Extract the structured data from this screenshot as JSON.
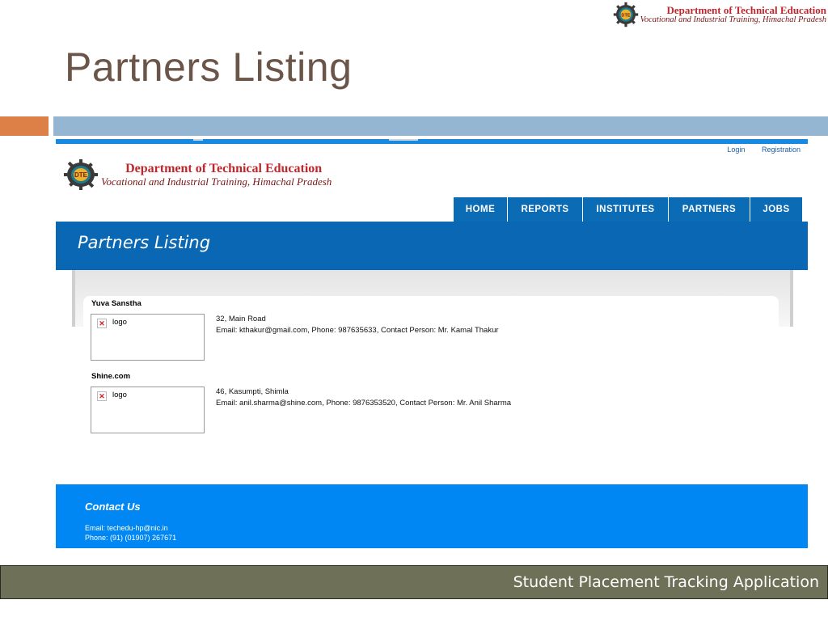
{
  "slide": {
    "title": "Partners Listing",
    "footer": "Student Placement Tracking Application",
    "logo": {
      "line1": "Department of Technical Education",
      "line2": "Vocational and Industrial Training, Himachal Pradesh"
    }
  },
  "site": {
    "top_links": [
      "Login",
      "Registration"
    ],
    "logo": {
      "line1": "Department of Technical Education",
      "line2": "Vocational and Industrial Training, Himachal Pradesh"
    },
    "nav": [
      {
        "label": "HOME"
      },
      {
        "label": "REPORTS"
      },
      {
        "label": "INSTITUTES"
      },
      {
        "label": "PARTNERS"
      },
      {
        "label": "JOBS"
      }
    ],
    "hero_title": "Partners Listing",
    "partners": [
      {
        "name": "Yuva Sanstha",
        "logo_alt": "logo",
        "address": "32, Main Road",
        "details": "Email: kthakur@gmail.com, Phone: 987635633, Contact Person: Mr. Kamal Thakur"
      },
      {
        "name": "Shine.com",
        "logo_alt": "logo",
        "address": "46, Kasumpti, Shimla",
        "details": "Email: anil.sharma@shine.com, Phone: 9876353520, Contact Person: Mr. Anil Sharma"
      }
    ],
    "contact": {
      "title": "Contact Us",
      "email": "Email: techedu-hp@nic.in",
      "phone": "Phone: (91) (01907) 267671"
    }
  },
  "colors": {
    "title_brown": "#6b5549",
    "accent_orange": "#dd8047",
    "accent_blue": "#94b6d2",
    "footer_olive": "#6e7157",
    "nav_blue": "#0b6bb5",
    "contact_blue": "#0087f3"
  },
  "icons": [
    "dte-gear-logo-icon",
    "broken-image-icon"
  ]
}
